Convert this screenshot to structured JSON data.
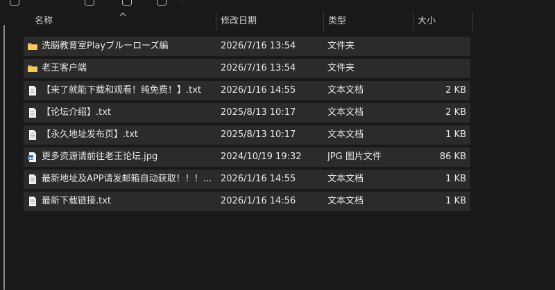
{
  "columns": {
    "name": "名称",
    "date": "修改日期",
    "type": "类型",
    "size": "大小"
  },
  "files": [
    {
      "name": "洗脳教育室Playブルーローズ編",
      "date": "2026/7/16 13:54",
      "type": "文件夹",
      "size": "",
      "icon": "folder-icon"
    },
    {
      "name": "老王客户端",
      "date": "2026/7/16 13:54",
      "type": "文件夹",
      "size": "",
      "icon": "folder-icon"
    },
    {
      "name": "【来了就能下载和观看！纯免费！】.txt",
      "date": "2026/1/16 14:55",
      "type": "文本文档",
      "size": "2 KB",
      "icon": "text-file-icon"
    },
    {
      "name": "【论坛介绍】.txt",
      "date": "2025/8/13 10:17",
      "type": "文本文档",
      "size": "2 KB",
      "icon": "text-file-icon"
    },
    {
      "name": "【永久地址发布页】.txt",
      "date": "2025/8/13 10:17",
      "type": "文本文档",
      "size": "1 KB",
      "icon": "text-file-icon"
    },
    {
      "name": "更多资源请前往老王论坛.jpg",
      "date": "2024/10/19 19:32",
      "type": "JPG 图片文件",
      "size": "86 KB",
      "icon": "image-file-icon"
    },
    {
      "name": "最新地址及APP请发邮箱自动获取！！！...",
      "date": "2026/1/16 14:55",
      "type": "文本文档",
      "size": "1 KB",
      "icon": "text-file-icon"
    },
    {
      "name": "最新下载链接.txt",
      "date": "2026/1/16 14:56",
      "type": "文本文档",
      "size": "1 KB",
      "icon": "text-file-icon"
    }
  ],
  "colors": {
    "background": "#191919",
    "row_background": "#2b2b2b",
    "folder": "#f0c24a",
    "text": "#e8e8e8"
  }
}
